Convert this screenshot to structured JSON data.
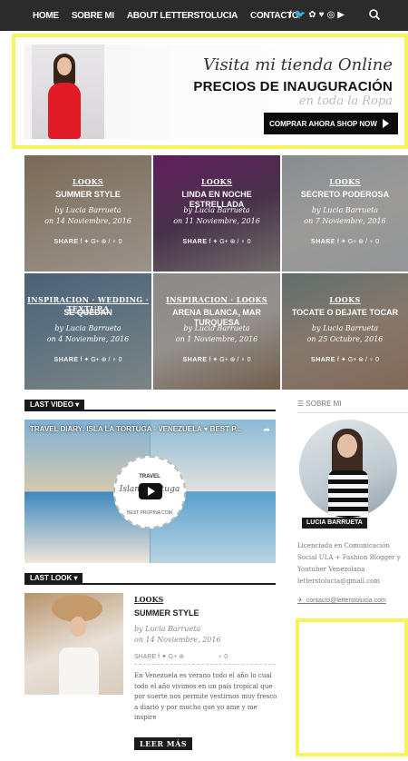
{
  "nav": {
    "links": [
      "HOME",
      "SOBRE MI",
      "ABOUT LETTERSTOLUCIA",
      "CONTACTO"
    ],
    "social": [
      "f",
      "🐦",
      "✿",
      "♥",
      "◎",
      "▶"
    ]
  },
  "banner": {
    "script": "Visita mi tienda Online",
    "headline": "PRECIOS DE INAUGURACIÓN",
    "sub": "en toda la Ropa",
    "cta": "COMPRAR AHORA SHOP NOW"
  },
  "posts": [
    {
      "category": "LOOKS",
      "title": "SUMMER STYLE",
      "author": "by Lucia Barrueta",
      "date": "on 14 Noviembre, 2016",
      "share": "SHARE"
    },
    {
      "category": "LOOKS",
      "title": "LINDA EN NOCHE ESTRELLADA",
      "author": "by Lucia Barrueta",
      "date": "on 11 Noviembre, 2016",
      "share": "SHARE"
    },
    {
      "category": "LOOKS",
      "title": "SECRETO PODEROSA",
      "author": "by Lucia Barrueta",
      "date": "on 7 Noviembre, 2016",
      "share": "SHARE"
    },
    {
      "category": "INSPIRACION · WEDDING · TEXTURA",
      "title": "SE QUEDAN",
      "author": "by Lucia Barrueta",
      "date": "on 4 Noviembre, 2016",
      "share": "SHARE"
    },
    {
      "category": "INSPIRACION · LOOKS",
      "title": "ARENA BLANCA, MAR TURQUESA",
      "author": "by Lucia Barrueta",
      "date": "on 1 Noviembre, 2016",
      "share": "SHARE"
    },
    {
      "category": "LOOKS",
      "title": "TOCATE O DEJATE TOCAR",
      "author": "by Lucia Barrueta",
      "date": "on 25 Octubre, 2016",
      "share": "SHARE"
    }
  ],
  "video_section": {
    "label": "LAST VIDEO",
    "title": "TRAVEL DIARY: ISLA LA TORTUGA - VENEZUELA ♥ BEST P...",
    "badge_top": "TRAVEL",
    "badge_script": "Island Tortuga",
    "badge_bottom": "BEST PROPINA COM"
  },
  "last_look": {
    "label": "LAST LOOK",
    "category": "LOOKS",
    "title": "SUMMER STYLE",
    "author": "by Lucia Barrueta",
    "date": "on 14 Noviembre, 2016",
    "share": "SHARE",
    "excerpt": "En Venezuela es verano todo el año lo cual todo el año vivimos en un país tropical que por suerte nos permite vestirnos muy fresco a diario y por mucho que yo ame y me inspire",
    "read_more": "LEER MÁS"
  },
  "sidebar": {
    "about_heading": "SOBRE MI",
    "name_tag": "LUCIA BARRUETA",
    "about_text": "Licenciada en Comunicación Social ULA + Fashion Blogger y Youtuber Venezolana letterstolucia@gmail.com",
    "link": "contacto@letterstolucia.com"
  },
  "colors": {
    "accent_yellow": "#f7f45a",
    "dark": "#1a1a1a"
  }
}
